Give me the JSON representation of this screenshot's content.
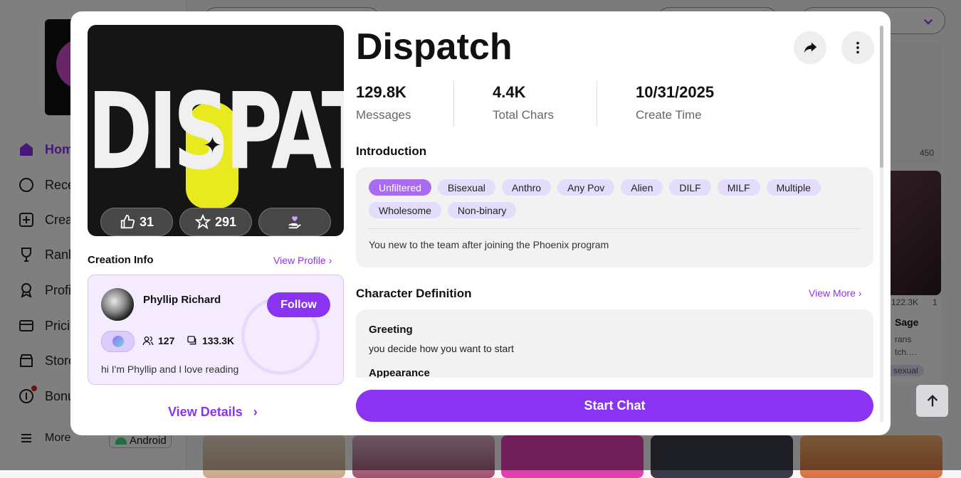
{
  "sidebar": {
    "items": [
      {
        "label": "Home",
        "icon": "home-icon",
        "active": true
      },
      {
        "label": "Rece",
        "icon": "chat-bubble-icon"
      },
      {
        "label": "Crea",
        "icon": "plus-square-icon"
      },
      {
        "label": "Rank",
        "icon": "trophy-icon"
      },
      {
        "label": "Profi",
        "icon": "badge-icon"
      },
      {
        "label": "Prici",
        "icon": "card-icon"
      },
      {
        "label": "Store",
        "icon": "store-icon"
      },
      {
        "label": "Bonu",
        "icon": "coin-icon"
      }
    ],
    "more_label": "More",
    "android_label": "Android"
  },
  "background_cards": {
    "count_450": "450",
    "meta_row": "122.3K",
    "meta_row2": "1",
    "name_fragment": "Sage",
    "desc_fragment_1": "rans",
    "desc_fragment_2": "tch.…",
    "tag_fragment": "sexual"
  },
  "modal": {
    "cover": {
      "title_art": "DISPATCH",
      "likes": "31",
      "stars": "291"
    },
    "title": "Dispatch",
    "stats": [
      {
        "value": "129.8K",
        "label": "Messages"
      },
      {
        "value": "4.4K",
        "label": "Total Chars"
      },
      {
        "value": "10/31/2025",
        "label": "Create Time"
      }
    ],
    "creation_info": {
      "heading": "Creation Info",
      "view_profile": "View Profile",
      "creator_name": "Phyllip Richard",
      "follow_label": "Follow",
      "followers": "127",
      "chats": "133.3K",
      "bio": "hi I'm Phyllip and I love reading"
    },
    "view_details": "View Details",
    "introduction": {
      "heading": "Introduction",
      "tags": [
        "Unfiltered",
        "Bisexual",
        "Anthro",
        "Any Pov",
        "Alien",
        "DILF",
        "MILF",
        "Multiple",
        "Wholesome",
        "Non-binary"
      ],
      "selected_tag": "Unfiltered",
      "text": "You new to the team after joining the Phoenix program"
    },
    "character_definition": {
      "heading": "Character Definition",
      "view_more": "View More",
      "greeting_heading": "Greeting",
      "greeting_text": "you decide how you want to start",
      "appearance_heading": "Appearance"
    },
    "start_chat": "Start Chat"
  },
  "colors": {
    "accent": "#8b33f2",
    "tag_bg": "#e4dcfb",
    "tag_selected": "#a96bf0"
  }
}
